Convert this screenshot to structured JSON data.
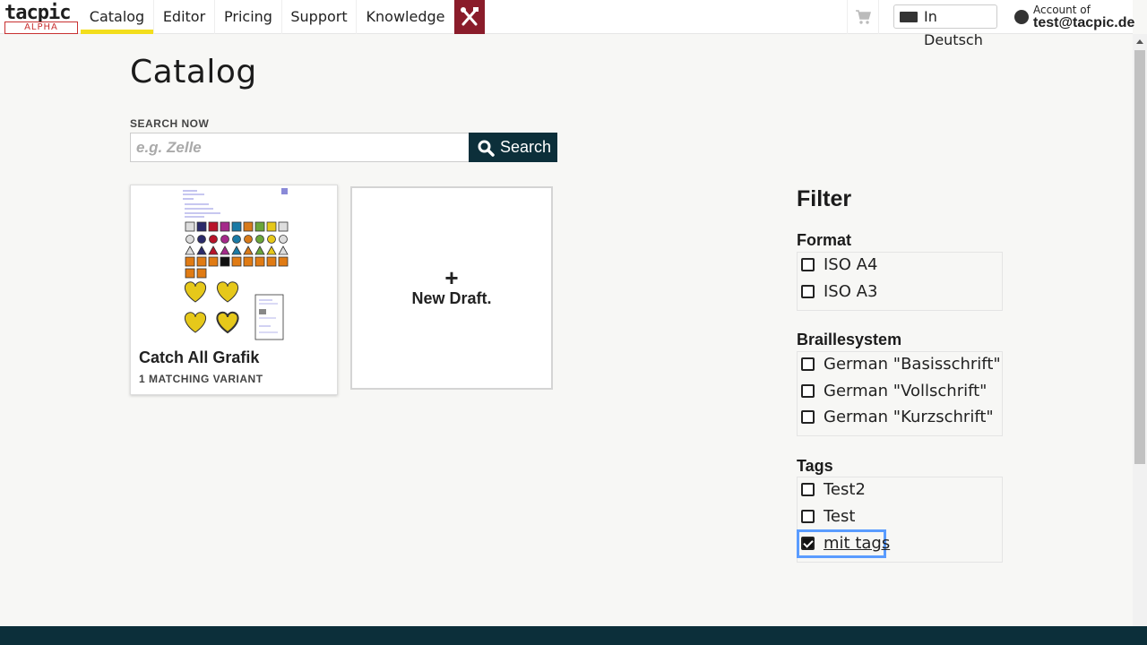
{
  "brand": {
    "name": "tacpic",
    "badge": "ALPHA"
  },
  "nav": {
    "links": [
      {
        "label": "Catalog",
        "active": true
      },
      {
        "label": "Editor",
        "active": false
      },
      {
        "label": "Pricing",
        "active": false
      },
      {
        "label": "Support",
        "active": false
      },
      {
        "label": "Knowledge",
        "active": false
      }
    ],
    "tools_icon": "tools-icon",
    "cart_icon": "cart-icon",
    "language_button": "In Deutsch",
    "account_caption": "Account of",
    "account_email": "test@tacpic.de"
  },
  "main": {
    "title": "Catalog",
    "search": {
      "label": "SEARCH NOW",
      "placeholder": "e.g. Zelle",
      "value": "",
      "button": "Search"
    },
    "card": {
      "title": "Catch All Grafik",
      "subtitle": "1 MATCHING VARIANT"
    },
    "new_draft": {
      "plus": "+",
      "label": "New Draft."
    }
  },
  "filter": {
    "title": "Filter",
    "groups": [
      {
        "title": "Format",
        "options": [
          {
            "label": "ISO A4",
            "checked": false
          },
          {
            "label": "ISO A3",
            "checked": false
          }
        ]
      },
      {
        "title": "Braillesystem",
        "options": [
          {
            "label": "German \"Basisschrift\"",
            "checked": false
          },
          {
            "label": "German \"Vollschrift\"",
            "checked": false
          },
          {
            "label": "German \"Kurzschrift\"",
            "checked": false
          }
        ]
      },
      {
        "title": "Tags",
        "options": [
          {
            "label": "Test2",
            "checked": false
          },
          {
            "label": "Test",
            "checked": false
          },
          {
            "label": "mit tags",
            "checked": true
          }
        ]
      }
    ]
  },
  "colors": {
    "accent": "#f3de1c",
    "dark": "#0c2f3a",
    "tools": "#8a1c2a",
    "focus": "#5a9cff"
  }
}
